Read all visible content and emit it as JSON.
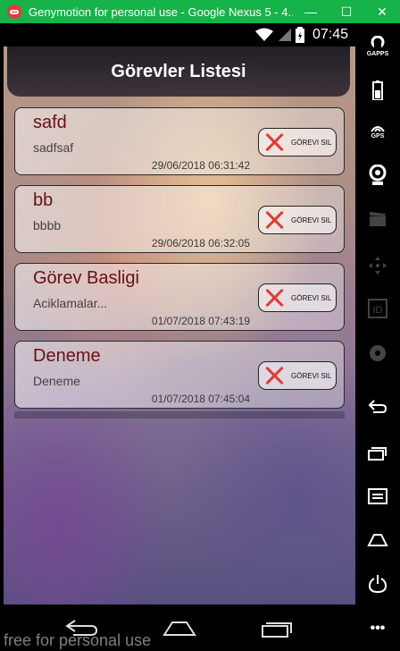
{
  "window": {
    "title": "Genymotion for personal use - Google Nexus 5 - 4...",
    "minimize": "—",
    "maximize": "☐",
    "close": "✕"
  },
  "status_bar": {
    "time": "07:45"
  },
  "app": {
    "title": "Görevler Listesi"
  },
  "tasks": [
    {
      "title": "safd",
      "description": "sadfsaf",
      "date": "29/06/2018 06:31:42",
      "delete_label": "GÖREVI SIL"
    },
    {
      "title": "bb",
      "description": "bbbb",
      "date": "29/06/2018 06:32:05",
      "delete_label": "GÖREVI SIL"
    },
    {
      "title": "Görev Basligi",
      "description": "Aciklamalar...",
      "date": "01/07/2018 07:43:19",
      "delete_label": "GÖREVI SIL"
    },
    {
      "title": "Deneme",
      "description": "Deneme",
      "date": "01/07/2018 07:45:04",
      "delete_label": "GÖREVI SIL"
    }
  ],
  "sidebar": {
    "gaps_label": "GAPPS",
    "gps_label": "GPS",
    "id_label": "ID",
    "more": "•••"
  },
  "watermark": "free for personal use",
  "colors": {
    "titlebar": "#16b34a",
    "task_title": "#6a0f16",
    "delete_x": "#e53935"
  }
}
